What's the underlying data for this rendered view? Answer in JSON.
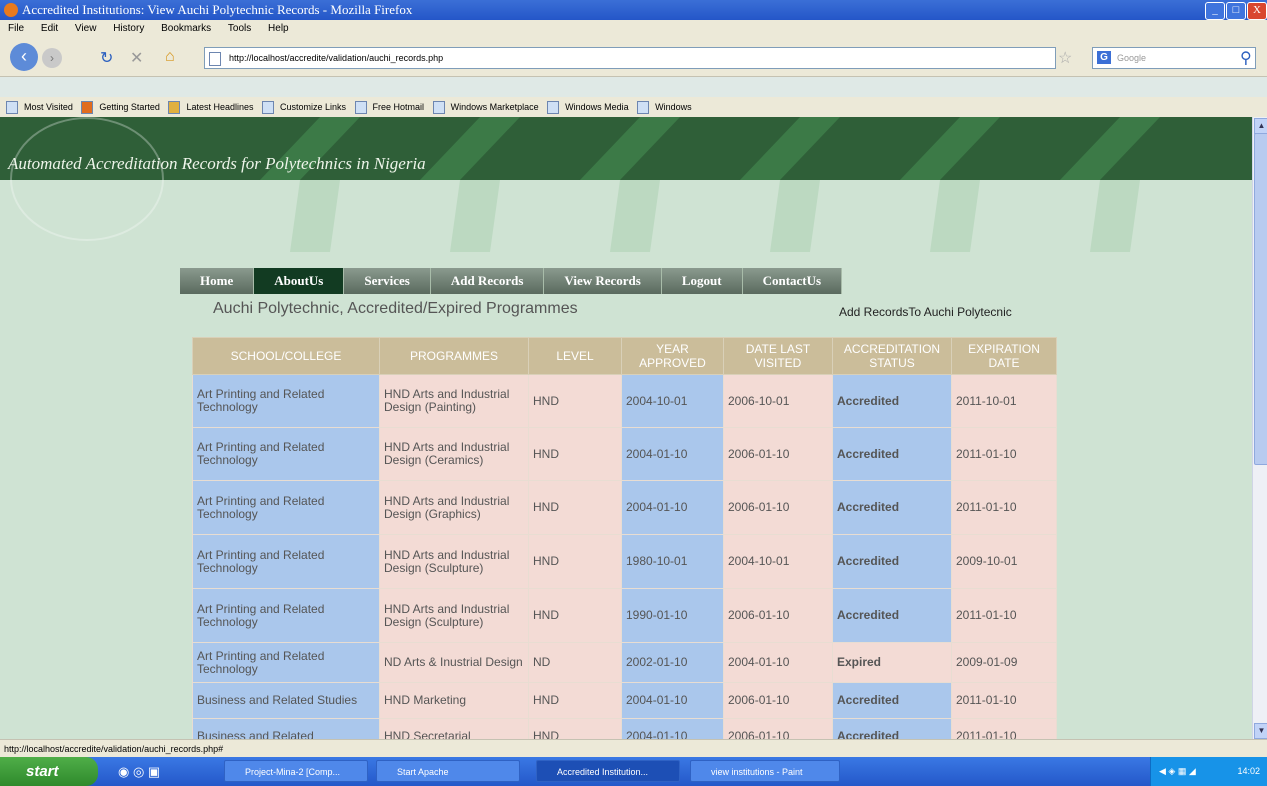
{
  "window": {
    "title": "Accredited Institutions: View Auchi Polytechnic Records - Mozilla Firefox",
    "minimize": "_",
    "maximize": "□",
    "close": "X"
  },
  "menu": [
    "File",
    "Edit",
    "View",
    "History",
    "Bookmarks",
    "Tools",
    "Help"
  ],
  "toolbar": {
    "url": "http://localhost/accredite/validation/auchi_records.php",
    "search_placeholder": "Google"
  },
  "bookmarks": [
    "Most Visited",
    "Getting Started",
    "Latest Headlines",
    "Customize Links",
    "Free Hotmail",
    "Windows Marketplace",
    "Windows Media",
    "Windows"
  ],
  "site": {
    "title": "Automated Accreditation Records for Polytechnics in Nigeria",
    "nav": [
      "Home",
      "AboutUs",
      "Services",
      "Add Records",
      "View Records",
      "Logout",
      "ContactUs"
    ],
    "active_nav": "AboutUs",
    "page_title": "Auchi Polytechnic, Accredited/Expired Programmes",
    "add_link": "Add RecordsTo Auchi Polytecnic"
  },
  "table": {
    "headers": [
      "SCHOOL/COLLEGE",
      "PROGRAMMES",
      "LEVEL",
      "YEAR APPROVED",
      "DATE LAST VISITED",
      "ACCREDITATION STATUS",
      "EXPIRATION DATE"
    ],
    "rows": [
      {
        "school": "Art Printing and Related Technology",
        "programme": "HND Arts and Industrial Design (Painting)",
        "level": "HND",
        "year": "2004-10-01",
        "visited": "2006-10-01",
        "status": "Accredited",
        "expiry": "2011-10-01"
      },
      {
        "school": "Art Printing and Related Technology",
        "programme": "HND Arts and Industrial Design (Ceramics)",
        "level": "HND",
        "year": "2004-01-10",
        "visited": "2006-01-10",
        "status": "Accredited",
        "expiry": "2011-01-10"
      },
      {
        "school": "Art Printing and Related Technology",
        "programme": "HND Arts and Industrial Design (Graphics)",
        "level": "HND",
        "year": "2004-01-10",
        "visited": "2006-01-10",
        "status": "Accredited",
        "expiry": "2011-01-10"
      },
      {
        "school": "Art Printing and Related Technology",
        "programme": "HND Arts and Industrial Design (Sculpture)",
        "level": "HND",
        "year": "1980-10-01",
        "visited": "2004-10-01",
        "status": "Accredited",
        "expiry": "2009-10-01"
      },
      {
        "school": "Art Printing and Related Technology",
        "programme": "HND Arts and Industrial Design (Sculpture)",
        "level": "HND",
        "year": "1990-01-10",
        "visited": "2006-01-10",
        "status": "Accredited",
        "expiry": "2011-01-10"
      },
      {
        "school": "Art Printing and Related Technology",
        "programme": "ND Arts & Inustrial Design",
        "level": "ND",
        "year": "2002-01-10",
        "visited": "2004-01-10",
        "status": "Expired",
        "expiry": "2009-01-09"
      },
      {
        "school": "Business and Related Studies",
        "programme": "HND Marketing",
        "level": "HND",
        "year": "2004-01-10",
        "visited": "2006-01-10",
        "status": "Accredited",
        "expiry": "2011-01-10"
      },
      {
        "school": "Business and Related",
        "programme": "HND Secretarial",
        "level": "HND",
        "year": "2004-01-10",
        "visited": "2006-01-10",
        "status": "Accredited",
        "expiry": "2011-01-10"
      }
    ]
  },
  "statusbar": "http://localhost/accredite/validation/auchi_records.php#",
  "taskbar": {
    "start": "start",
    "tasks": [
      "Project-Mina-2 [Comp...",
      "Start Apache",
      "Accredited Institution...",
      "view institutions - Paint"
    ],
    "clock": "14:02"
  },
  "colors": {
    "banner": "#2f5f38",
    "nav_active": "#123b22",
    "header": "#cbbd9a",
    "cell_blue": "#aac7ec",
    "cell_pink": "#f3dbd5",
    "accredited": "#1b7d3a",
    "expired": "#d01010"
  }
}
